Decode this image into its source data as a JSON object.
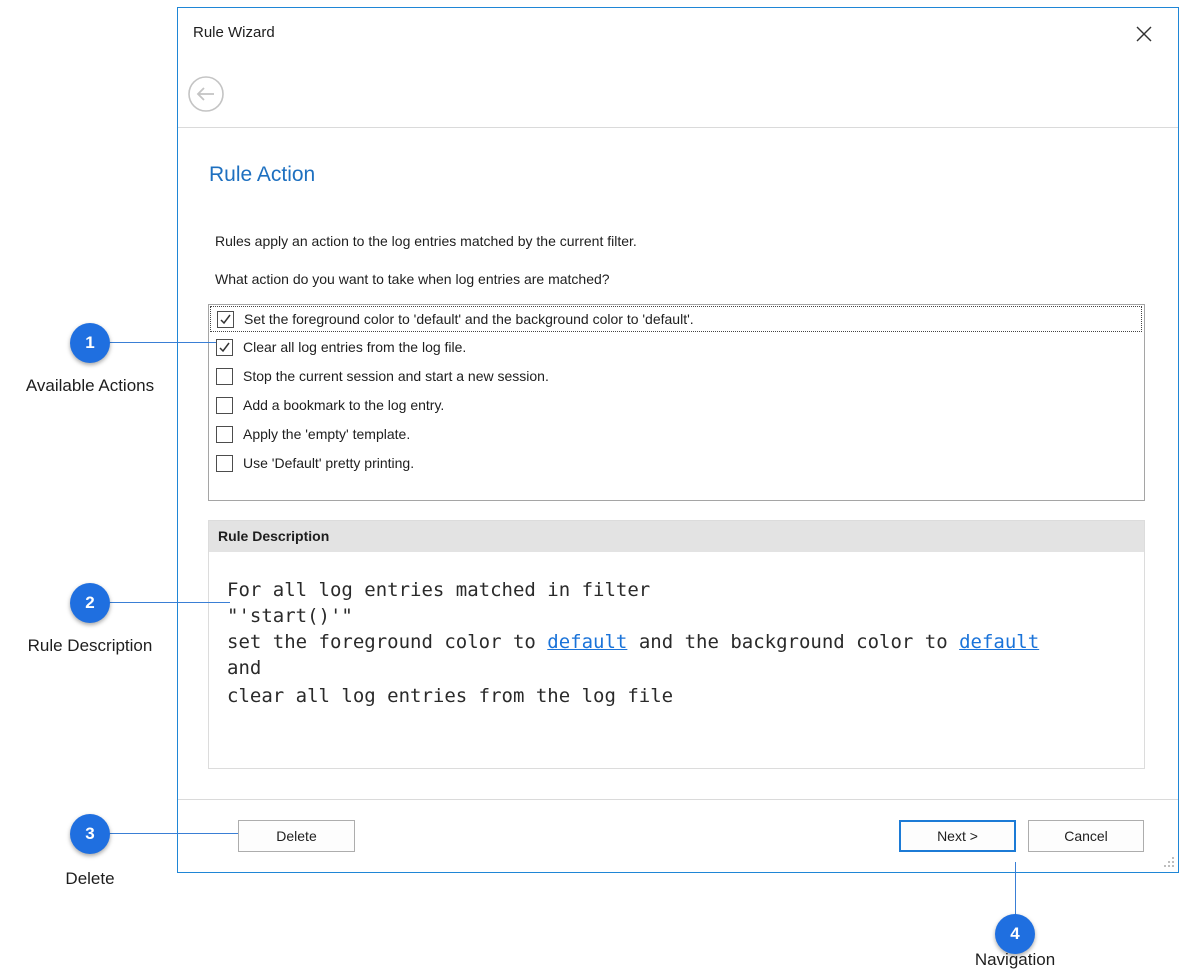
{
  "window": {
    "title": "Rule Wizard",
    "heading": "Rule Action",
    "intro": [
      "Rules apply an action to the log entries matched by the current filter.",
      "What action do you want to take when log entries are matched?"
    ]
  },
  "actions": [
    {
      "label": "Set the foreground color to 'default' and the background color to 'default'.",
      "checked": true
    },
    {
      "label": "Clear all log entries from the log file.",
      "checked": true
    },
    {
      "label": "Stop the current session and start a new session.",
      "checked": false
    },
    {
      "label": "Add a bookmark to the log entry.",
      "checked": false
    },
    {
      "label": "Apply the 'empty' template.",
      "checked": false
    },
    {
      "label": "Use 'Default' pretty printing.",
      "checked": false
    }
  ],
  "description": {
    "header": "Rule Description",
    "line1": "For all log entries matched in filter",
    "line2": "\"'start()'\"",
    "line3_a": "set the foreground color to ",
    "line3_link1": "default",
    "line3_b": " and the background color to ",
    "line3_link2": "default",
    "line4": "and",
    "line5": "clear all log entries from the log file"
  },
  "buttons": {
    "delete": "Delete",
    "next": "Next >",
    "cancel": "Cancel"
  },
  "callouts": [
    {
      "number": "1",
      "label": "Available Actions"
    },
    {
      "number": "2",
      "label": "Rule Description"
    },
    {
      "number": "3",
      "label": "Delete"
    },
    {
      "number": "4",
      "label": "Navigation"
    }
  ],
  "colors": {
    "accent": "#1e70c0",
    "link": "#1a73d9",
    "callout": "#1f6fe0",
    "window_border": "#1f86d6"
  }
}
